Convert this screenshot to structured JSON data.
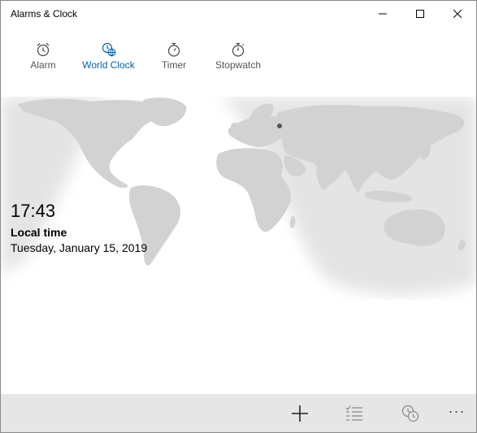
{
  "window": {
    "title": "Alarms & Clock",
    "controls": [
      "minimize-icon",
      "maximize-icon",
      "close-icon"
    ]
  },
  "tabs": [
    {
      "label": "Alarm",
      "icon": "alarm-clock-icon",
      "active": false
    },
    {
      "label": "World Clock",
      "icon": "world-clock-icon",
      "active": true
    },
    {
      "label": "Timer",
      "icon": "timer-icon",
      "active": false
    },
    {
      "label": "Stopwatch",
      "icon": "stopwatch-icon",
      "active": false
    }
  ],
  "local_time": {
    "time": "17:43",
    "label": "Local time",
    "date": "Tuesday, January 15, 2019"
  },
  "command_bar": [
    {
      "icon": "add-icon"
    },
    {
      "icon": "select-list-icon"
    },
    {
      "icon": "compare-clocks-icon"
    },
    {
      "icon": "more-icon",
      "label": "···"
    }
  ],
  "colors": {
    "accent": "#0078d7",
    "active_tab_text": "#0063b1",
    "map_land_day": "#d4d4d4",
    "map_land_night": "#c8c8c8",
    "night_shade": "#e8e8e8",
    "command_bar_bg": "#e6e6e6"
  }
}
